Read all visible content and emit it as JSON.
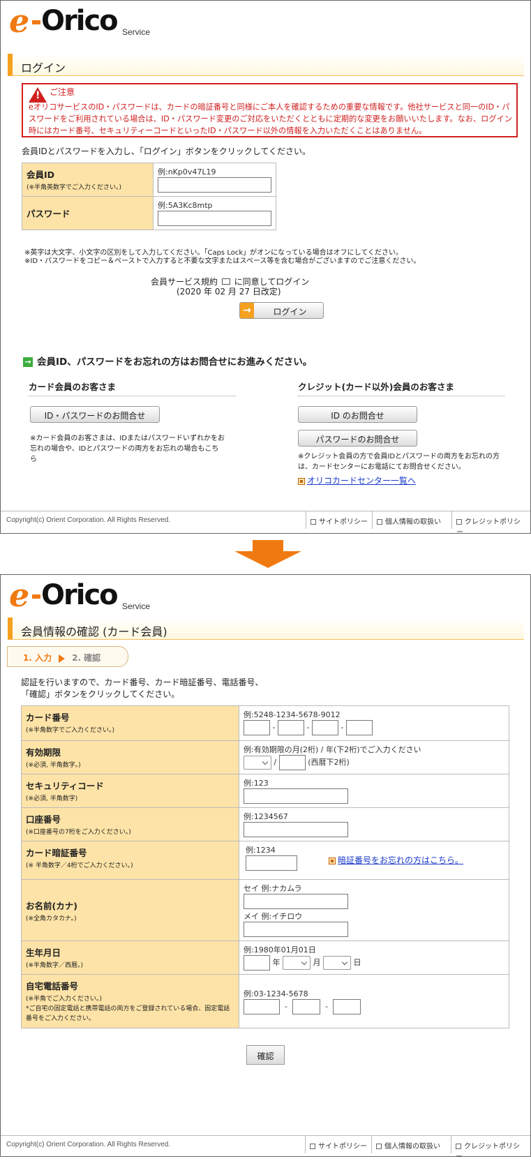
{
  "logo": {
    "e": "e",
    "orico": "Orico",
    "service": "Service"
  },
  "login": {
    "title": "ログイン",
    "caution_title": "ご注意",
    "caution_body": "eオリコサービスのID・パスワードは、カードの暗証番号と同様にご本人を確認するための重要な情報です。他社サービスと同一のID・パスワードをご利用されている場合は、ID・パスワード変更のご対応をいただくとともに定期的な変更をお願いいたします。なお、ログイン時にはカード番号、セキュリティーコードといったID・パスワード以外の情報を入力いただくことはありません。",
    "instruction": "会員IDとパスワードを入力し、「ログイン」ボタンをクリックしてください。",
    "id_label": "会員ID",
    "id_note": "(※半角英数字でご入力ください。)",
    "id_example": "例:nKp0v47L19",
    "pw_label": "パスワード",
    "pw_example": "例:5A3Kc8mtp",
    "note1": "※英字は大文字、小文字の区別をして入力してください。「Caps Lock」がオンになっている場合はオフにしてください。",
    "note2": "※ID・パスワードをコピー＆ペーストで入力すると不要な文字またはスペース等を含む場合がございますのでご注意ください。",
    "terms": "会員サービス規約",
    "terms_suffix": "に同意してログイン",
    "terms_date": "(2020 年 02 月 27 日改定)",
    "login_button": "ログイン",
    "forgot_heading": "会員ID、パスワードをお忘れの方はお問合せにお進みください。",
    "card_member": "カード会員のお客さま",
    "card_button": "ID・パスワードのお問合せ",
    "card_note": "※カード会員のお客さまは、IDまたはパスワードいずれかをお忘れの場合や、IDとパスワードの両方をお忘れの場合もこちら",
    "credit_member": "クレジット(カード以外)会員のお客さま",
    "id_inquiry_button": "ID のお問合せ",
    "pw_inquiry_button": "パスワードのお問合せ",
    "credit_note": "※クレジット会員の方で会員IDとパスワードの両方をお忘れの方は、カードセンターにお電話にてお問合せください。",
    "center_link": "オリコカードセンター一覧へ"
  },
  "footer": {
    "copyright": "Copyright(c) Orient Corporation. All Rights Reserved.",
    "site_policy": "サイトポリシー",
    "privacy": "個人情報の取扱い",
    "credit_policy": "クレジットポリシー"
  },
  "confirm": {
    "title": "会員情報の確認 (カード会員)",
    "step1": "1. 入力",
    "step2": "2. 確認",
    "instruction1": "認証を行いますので、カード番号、カード暗証番号、電話番号、",
    "instruction2": "「確認」ボタンをクリックしてください。",
    "rows": [
      {
        "label": "カード番号",
        "note": "(※半角数字でご入力ください。)",
        "example": "例:5248-1234-5678-9012"
      },
      {
        "label": "有効期限",
        "note": "(※必須, 半角数字。)",
        "example": "例:有効期限の月(2桁) / 年(下2桁)でご入力ください",
        "suffix": "(西暦下2桁)"
      },
      {
        "label": "セキュリティコード",
        "note": "(※必須, 半角数字)",
        "example": "例:123"
      },
      {
        "label": "口座番号",
        "note": "(※口座番号の7桁をご入力ください。)",
        "example": "例:1234567"
      },
      {
        "label": "カード暗証番号",
        "note": "(※ 半角数字／4桁でご入力ください。)",
        "example": "例:1234",
        "link": "暗証番号をお忘れの方はこちら。"
      },
      {
        "label": "お名前(カナ)",
        "note": "(※全角カタカナ。)",
        "example": "セイ 例:ナカムラ",
        "example2": "メイ 例:イチロウ"
      },
      {
        "label": "生年月日",
        "note": "(※半角数字／西暦。)",
        "example": "例:1980年01月01日",
        "y": "年",
        "m": "月",
        "d": "日"
      },
      {
        "label": "自宅電話番号",
        "note": "(※半角でご入力ください。)",
        "note2": "*ご自宅の固定電話と携帯電話の両方をご登録されている場合、固定電話番号をご入力ください。",
        "example": "例:03-1234-5678"
      }
    ],
    "confirm_button": "確認"
  }
}
